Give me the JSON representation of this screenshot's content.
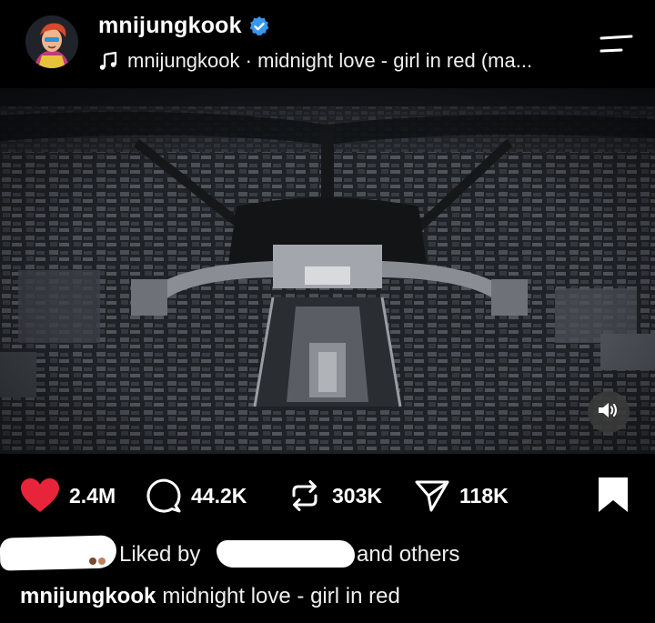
{
  "post": {
    "username": "mnijungkook",
    "audio_label": "mnijungkook · midnight love - girl in red (ma...",
    "is_verified": true
  },
  "media": {
    "description_icon": "sound-on-icon"
  },
  "actions": {
    "likes": "2.4M",
    "comments": "44.2K",
    "reposts": "303K",
    "shares": "118K",
    "like_color": "#e8243b"
  },
  "liked_by": {
    "prefix": "Liked by",
    "suffix": "and others"
  },
  "caption": {
    "username": "mnijungkook",
    "text": "midnight love - girl in red"
  },
  "colors": {
    "background": "#000000",
    "verified_blue": "#3897f0"
  }
}
